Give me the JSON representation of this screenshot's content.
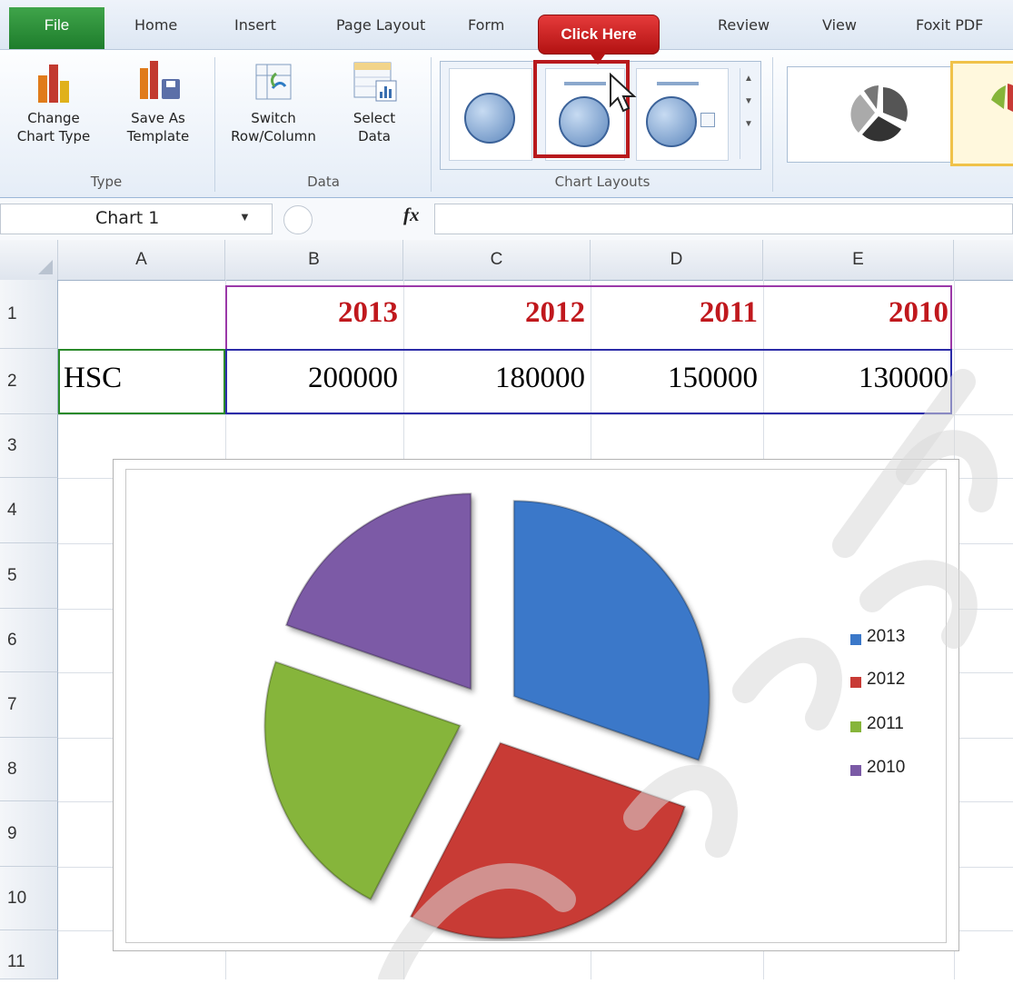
{
  "ribbon": {
    "tabs": [
      "File",
      "Home",
      "Insert",
      "Page Layout",
      "Form",
      "Review",
      "View",
      "Foxit PDF"
    ],
    "buttons": {
      "change_chart_type": [
        "Change",
        "Chart Type"
      ],
      "save_as_template": [
        "Save As",
        "Template"
      ],
      "switch_row_column": [
        "Switch",
        "Row/Column"
      ],
      "select_data": [
        "Select",
        "Data"
      ]
    },
    "groups": {
      "type": "Type",
      "data": "Data",
      "chart_layouts": "Chart Layouts"
    },
    "callout": "Click Here"
  },
  "formula_bar": {
    "name_box": "Chart 1",
    "fx": "fx",
    "formula": ""
  },
  "grid": {
    "columns": [
      "A",
      "B",
      "C",
      "D",
      "E"
    ],
    "rows": [
      "1",
      "2",
      "3",
      "4",
      "5",
      "6",
      "7",
      "8",
      "9",
      "10",
      "11"
    ],
    "row1": [
      "",
      "2013",
      "2012",
      "2011",
      "2010"
    ],
    "row2": [
      "HSC",
      "200000",
      "180000",
      "150000",
      "130000"
    ]
  },
  "chart_data": {
    "type": "pie",
    "exploded": true,
    "categories": [
      "2013",
      "2012",
      "2011",
      "2010"
    ],
    "values": [
      200000,
      180000,
      150000,
      130000
    ],
    "colors": [
      "#3b78c9",
      "#c83a35",
      "#86b53a",
      "#7b5aa6"
    ],
    "legend_position": "right",
    "title": ""
  }
}
